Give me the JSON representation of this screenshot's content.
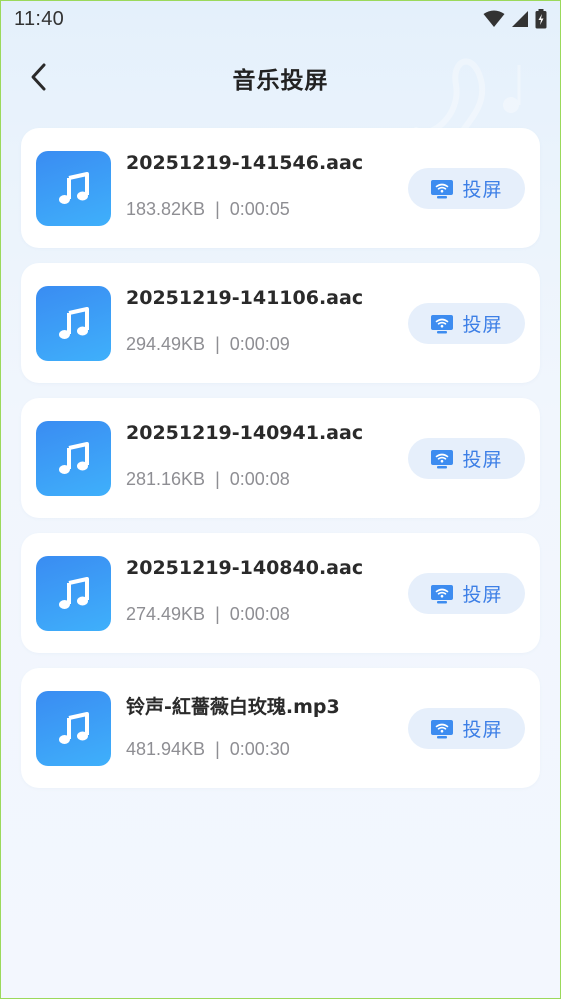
{
  "status_bar": {
    "time": "11:40",
    "icons": [
      "wifi-icon",
      "signal-icon",
      "battery-charging-icon"
    ]
  },
  "header": {
    "title": "音乐投屏",
    "back_icon": "chevron-left-icon"
  },
  "files": [
    {
      "name": "20251219-141546.aac",
      "size": "183.82KB",
      "separator": "|",
      "duration": "0:00:05",
      "cast_label": "投屏"
    },
    {
      "name": "20251219-141106.aac",
      "size": "294.49KB",
      "separator": "|",
      "duration": "0:00:09",
      "cast_label": "投屏"
    },
    {
      "name": "20251219-140941.aac",
      "size": "281.16KB",
      "separator": "|",
      "duration": "0:00:08",
      "cast_label": "投屏"
    },
    {
      "name": "20251219-140840.aac",
      "size": "274.49KB",
      "separator": "|",
      "duration": "0:00:08",
      "cast_label": "投屏"
    },
    {
      "name": "铃声-紅薔薇白玫瑰.mp3",
      "size": "481.94KB",
      "separator": "|",
      "duration": "0:00:30",
      "cast_label": "投屏"
    }
  ],
  "colors": {
    "accent": "#3d7fe6",
    "thumb_gradient_start": "#3a8cf2",
    "thumb_gradient_end": "#3fb0fb",
    "cast_button_bg": "#e6effb",
    "meta_text": "#8e8e93"
  }
}
